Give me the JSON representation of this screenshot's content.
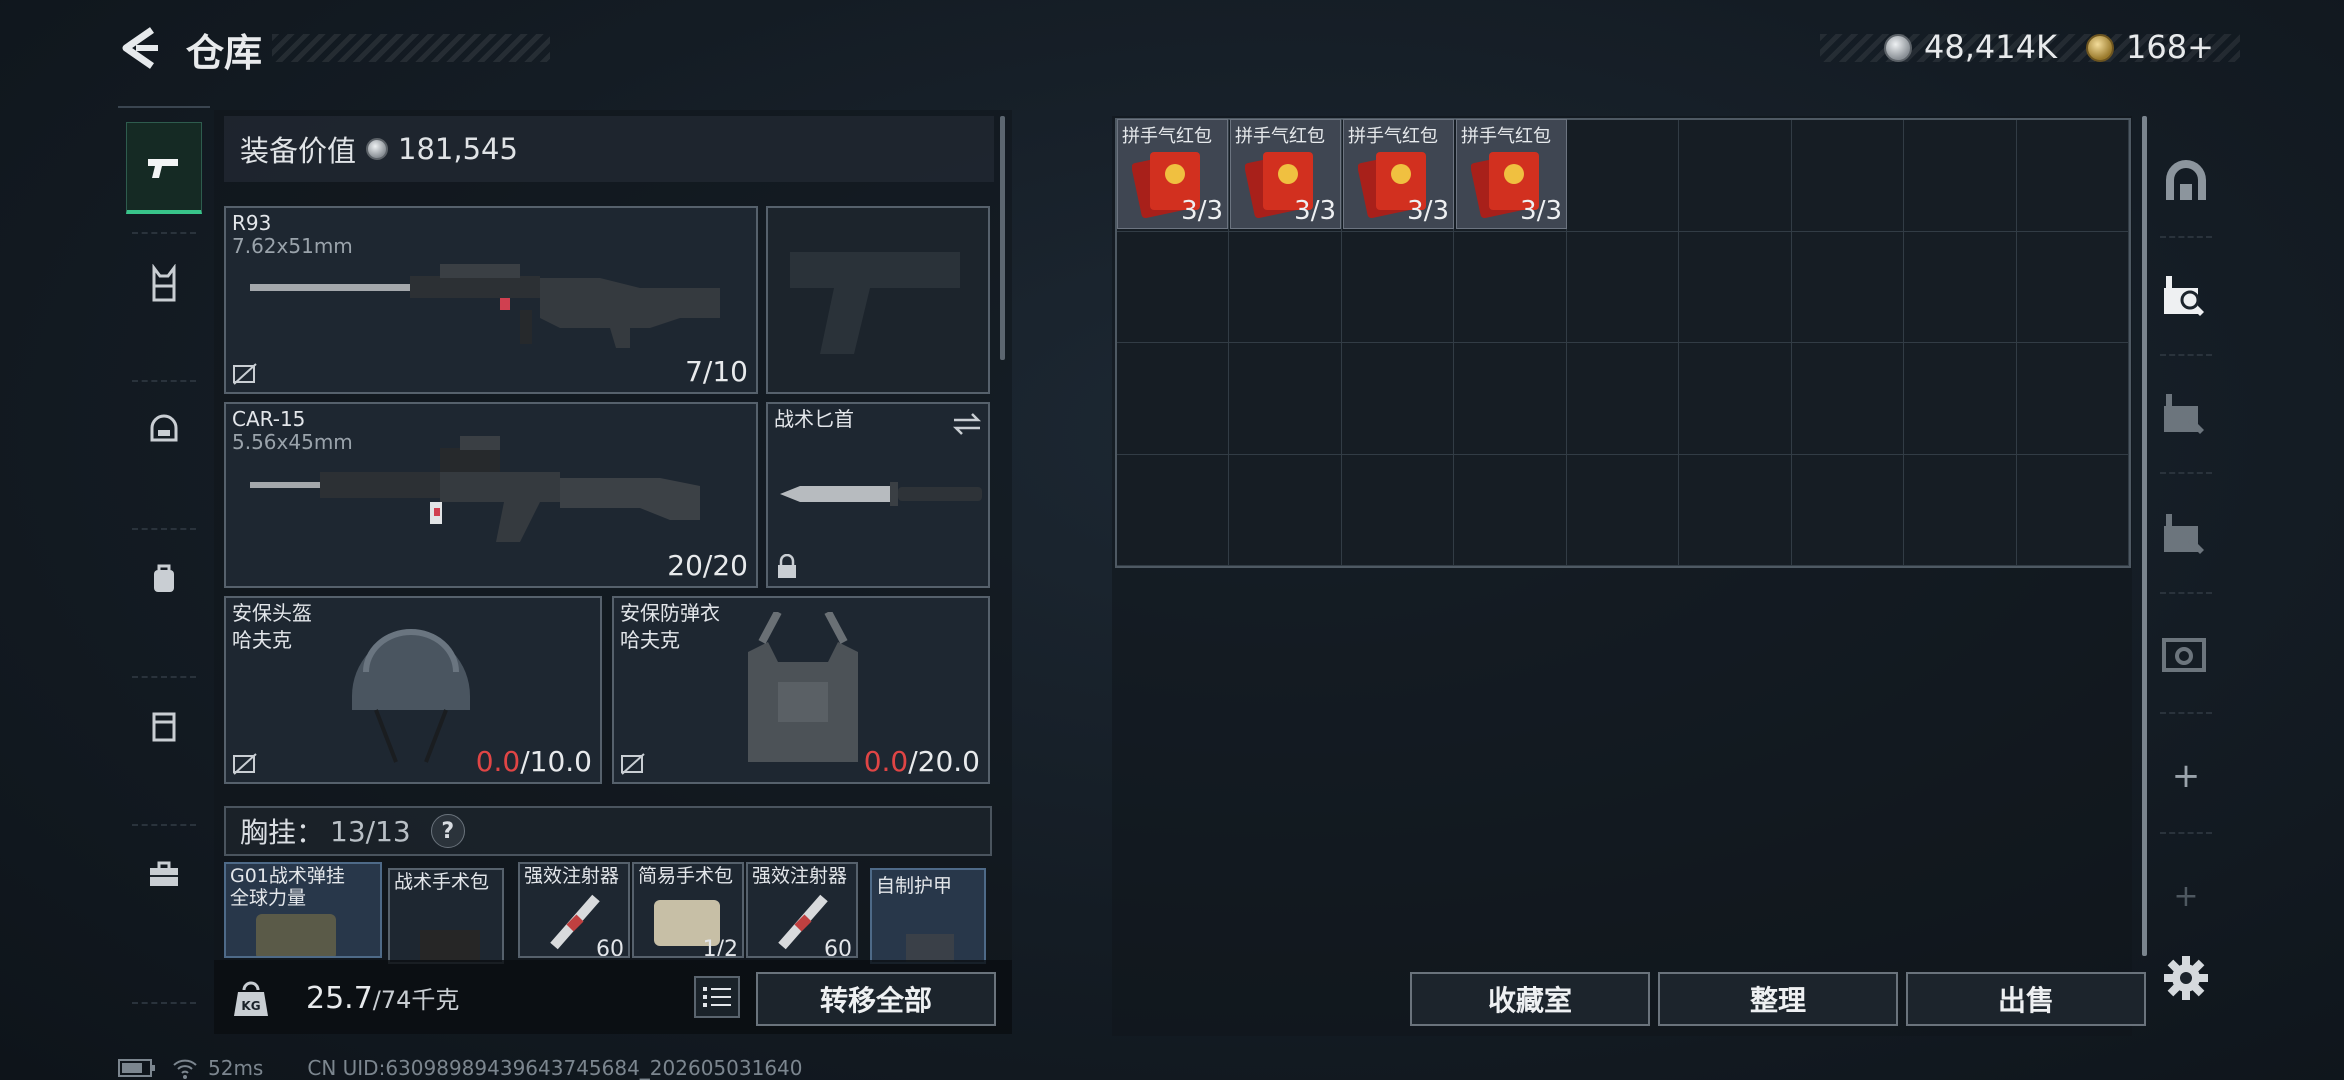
{
  "header": {
    "title": "仓库"
  },
  "currency": {
    "silver": "48,414K",
    "gold": "168+"
  },
  "sidebar": {
    "items": [
      "weapons-icon",
      "vest-icon",
      "helmet-icon",
      "backpack-icon",
      "case-icon",
      "toolbox-icon"
    ]
  },
  "equipment": {
    "value_label": "装备价值",
    "value": "181,545",
    "primary": {
      "name": "R93",
      "caliber": "7.62x51mm",
      "ammo": "7/10"
    },
    "pistol": {
      "name": "",
      "ammo": ""
    },
    "secondary": {
      "name": "CAR-15",
      "caliber": "5.56x45mm",
      "ammo": "20/20"
    },
    "melee": {
      "name": "战术匕首"
    },
    "helmet": {
      "name": "安保头盔",
      "brand": "哈夫克",
      "dur_cur": "0.0",
      "dur_max": "/10.0"
    },
    "armor": {
      "name": "安保防弹衣",
      "brand": "哈夫克",
      "dur_cur": "0.0",
      "dur_max": "/20.0"
    },
    "chest": {
      "label": "胸挂：",
      "count": "13/13",
      "help": "?"
    },
    "chest_items": [
      {
        "name": "G01战术弹挂",
        "sub": "全球力量"
      },
      {
        "name": "战术手术包"
      },
      {
        "name": "强效注射器",
        "qty": "60"
      },
      {
        "name": "简易手术包",
        "qty": "1/2"
      },
      {
        "name": "强效注射器",
        "qty": "60"
      },
      {
        "name": "自制护甲"
      }
    ]
  },
  "weight": {
    "value": "25.7",
    "max": "/74千克"
  },
  "buttons": {
    "transfer_all": "转移全部",
    "collection": "收藏室",
    "sort": "整理",
    "sell": "出售"
  },
  "storage": {
    "items": [
      {
        "name": "拼手气红包",
        "qty": "3/3"
      },
      {
        "name": "拼手气红包",
        "qty": "3/3"
      },
      {
        "name": "拼手气红包",
        "qty": "3/3"
      },
      {
        "name": "拼手气红包",
        "qty": "3/3"
      }
    ]
  },
  "rail": {
    "items": [
      "safehouse-icon",
      "storage-tab-1-icon",
      "storage-tab-2-icon",
      "storage-tab-3-icon",
      "storage-tab-v-icon",
      "add-icon",
      "add-icon",
      "settings-icon"
    ],
    "add": "+"
  },
  "footer": {
    "ping": "52ms",
    "uid": "CN UID:63098989439643745684_202605031640"
  },
  "colors": {
    "accent": "#38c48a",
    "red": "#e04545",
    "redpacket": "#c8281e"
  }
}
